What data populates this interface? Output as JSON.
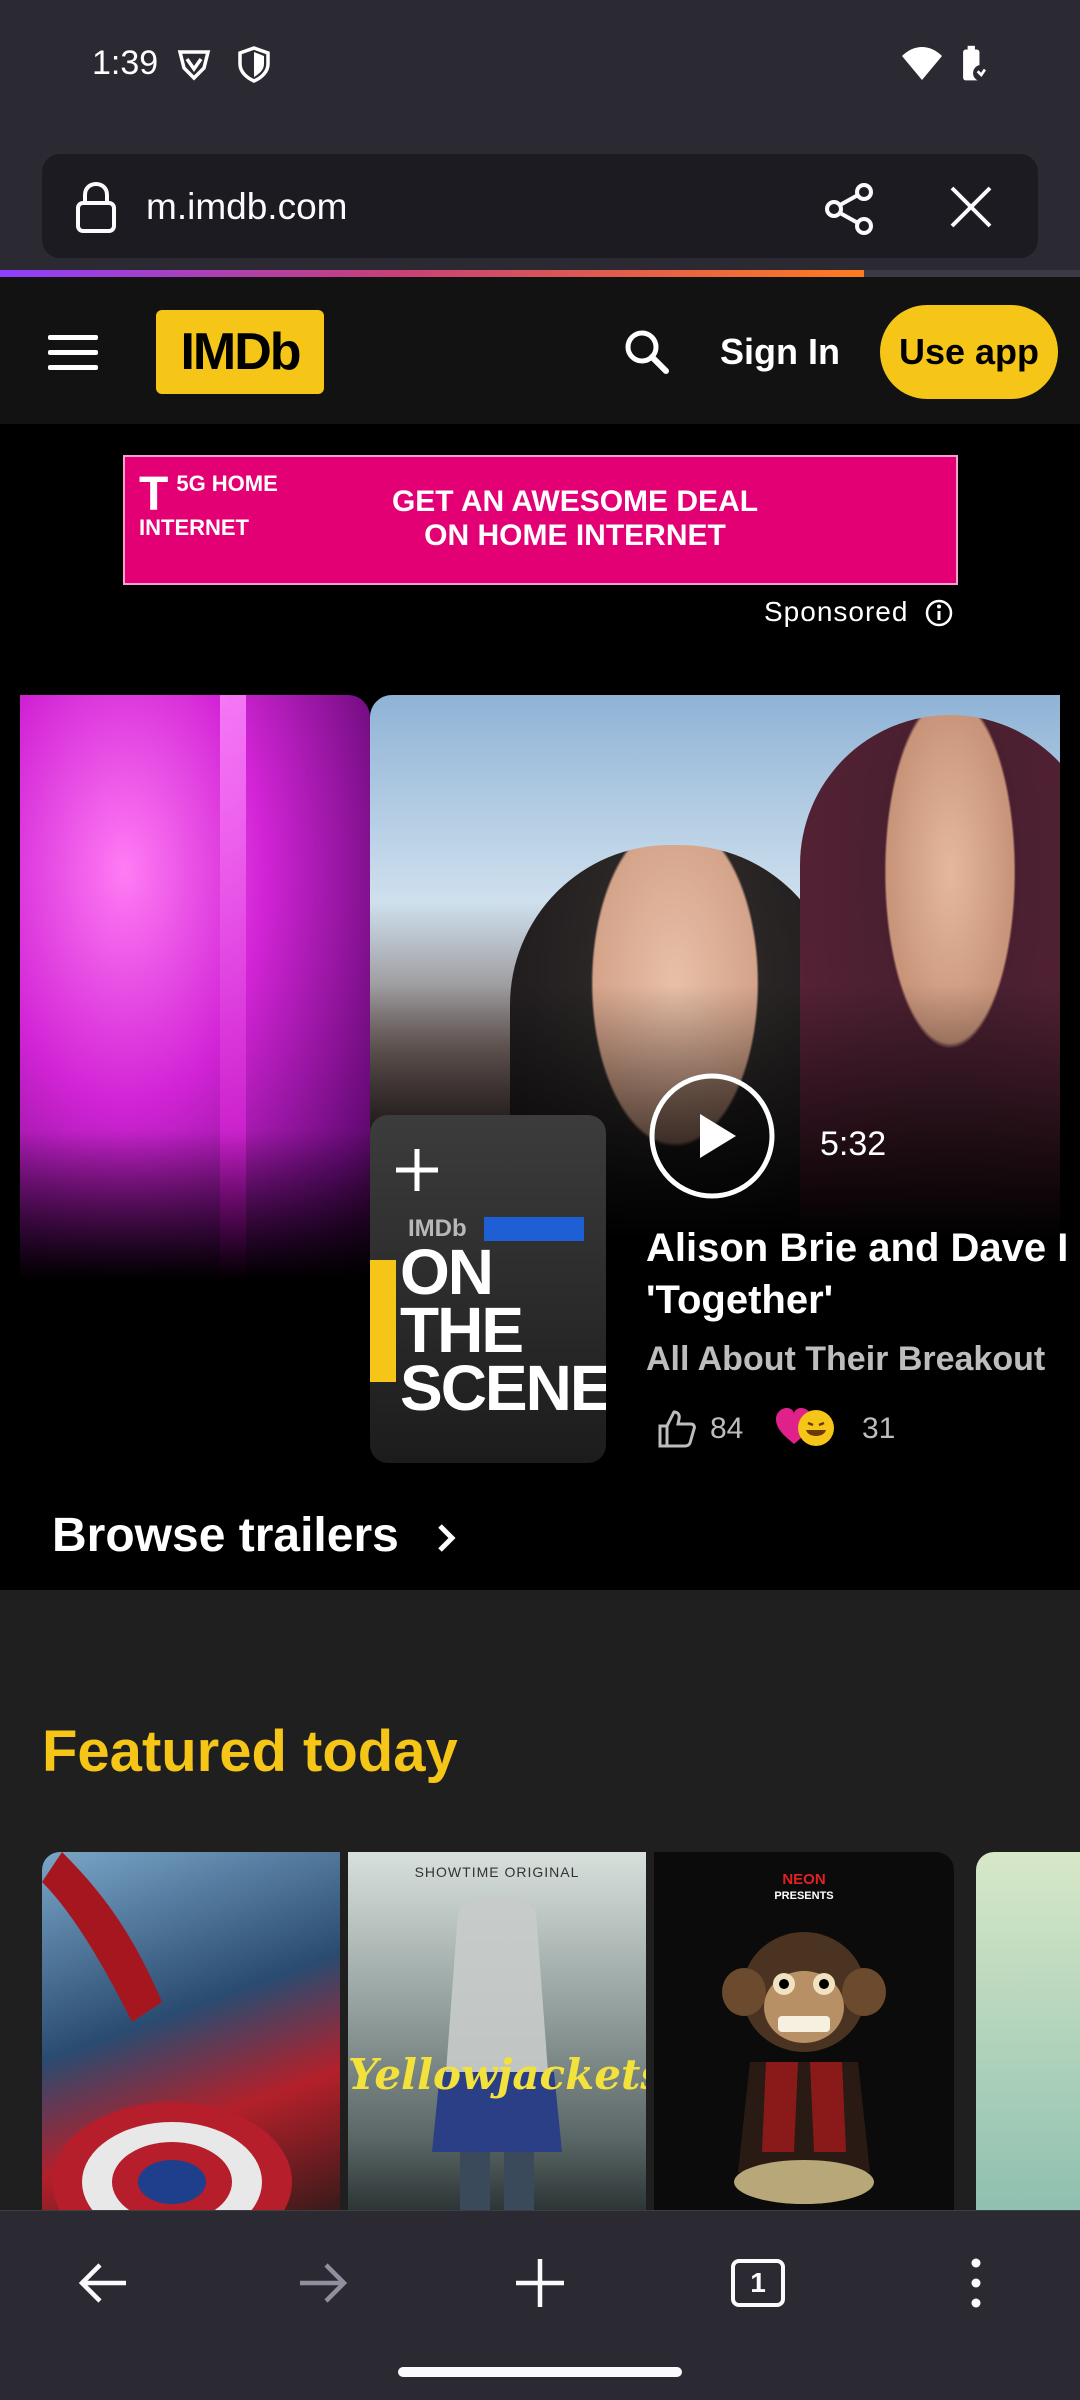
{
  "status_bar": {
    "time": "1:39"
  },
  "browser": {
    "url": "m.imdb.com",
    "load_progress_percent": 80,
    "toolbar": {
      "tabs_count": "1"
    }
  },
  "header": {
    "logo": "IMDb",
    "sign_in": "Sign In",
    "use_app": "Use app"
  },
  "ad": {
    "brand_line1": "5G HOME",
    "brand_line2": "INTERNET",
    "headline_line1": "GET AN AWESOME DEAL",
    "headline_line2": "ON HOME INTERNET",
    "sponsored_label": "Sponsored"
  },
  "hero": {
    "thumbnail_imdb": "IMDb",
    "thumbnail_title_line1": "ON THE",
    "thumbnail_title_line2": "SCENE",
    "duration": "5:32",
    "title_line1": "Alison Brie and Dave I",
    "title_line2": "'Together'",
    "subtitle": "All About Their Breakout",
    "likes": "84",
    "reactions": "31",
    "browse_trailers": "Browse trailers"
  },
  "featured": {
    "title": "Featured today",
    "posters": [
      {
        "label": ""
      },
      {
        "label": "SHOWTIME ORIGINAL",
        "logo": "Yellowjackets"
      },
      {
        "label": "NEON",
        "sublabel": "PRESENTS"
      },
      {
        "label": ""
      }
    ]
  },
  "colors": {
    "imdb_yellow": "#f5c518",
    "ad_magenta": "#e20074",
    "browser_chrome": "#2b2a33"
  }
}
